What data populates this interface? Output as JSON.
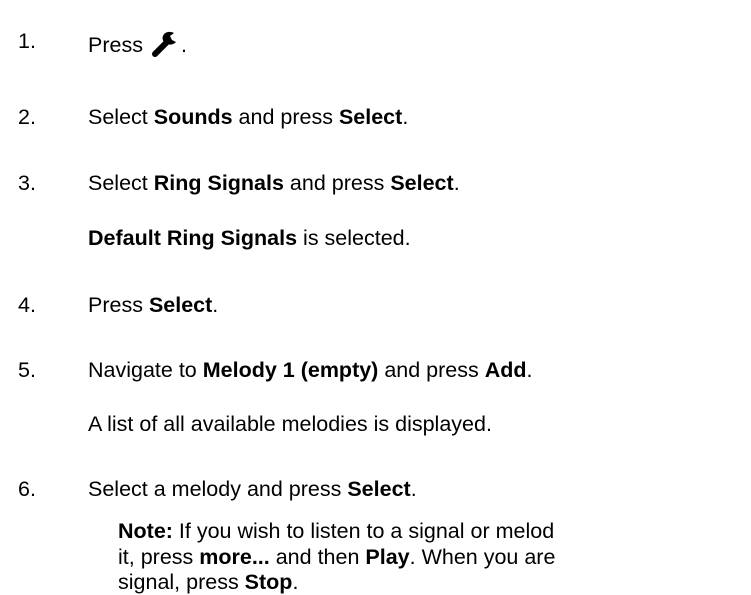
{
  "steps": [
    {
      "number": "1.",
      "parts": [
        "Press",
        "."
      ],
      "icon": "wrench-icon"
    },
    {
      "number": "2.",
      "parts": [
        "Select ",
        "Sounds",
        " and press ",
        "Select",
        "."
      ]
    },
    {
      "number": "3.",
      "parts": [
        "Select ",
        "Ring Signals",
        " and press ",
        "Select",
        "."
      ],
      "sub": [
        "Default Ring Signals",
        " is selected."
      ]
    },
    {
      "number": "4.",
      "parts": [
        "Press ",
        "Select",
        "."
      ]
    },
    {
      "number": "5.",
      "parts": [
        "Navigate to ",
        "Melody 1 (empty)",
        " and press ",
        "Add",
        "."
      ],
      "sub": [
        "A list of all available melodies is displayed."
      ]
    },
    {
      "number": "6.",
      "parts": [
        "Select a melody and press ",
        "Select",
        "."
      ]
    }
  ],
  "note": {
    "label": "Note:",
    "line1": " If you wish to listen to a signal or melod",
    "line2_a": "it, press ",
    "line2_b": "more...",
    "line2_c": " and then ",
    "line2_d": "Play",
    "line2_e": ". When you are",
    "line3_a": "signal, press ",
    "line3_b": "Stop",
    "line3_c": "."
  }
}
